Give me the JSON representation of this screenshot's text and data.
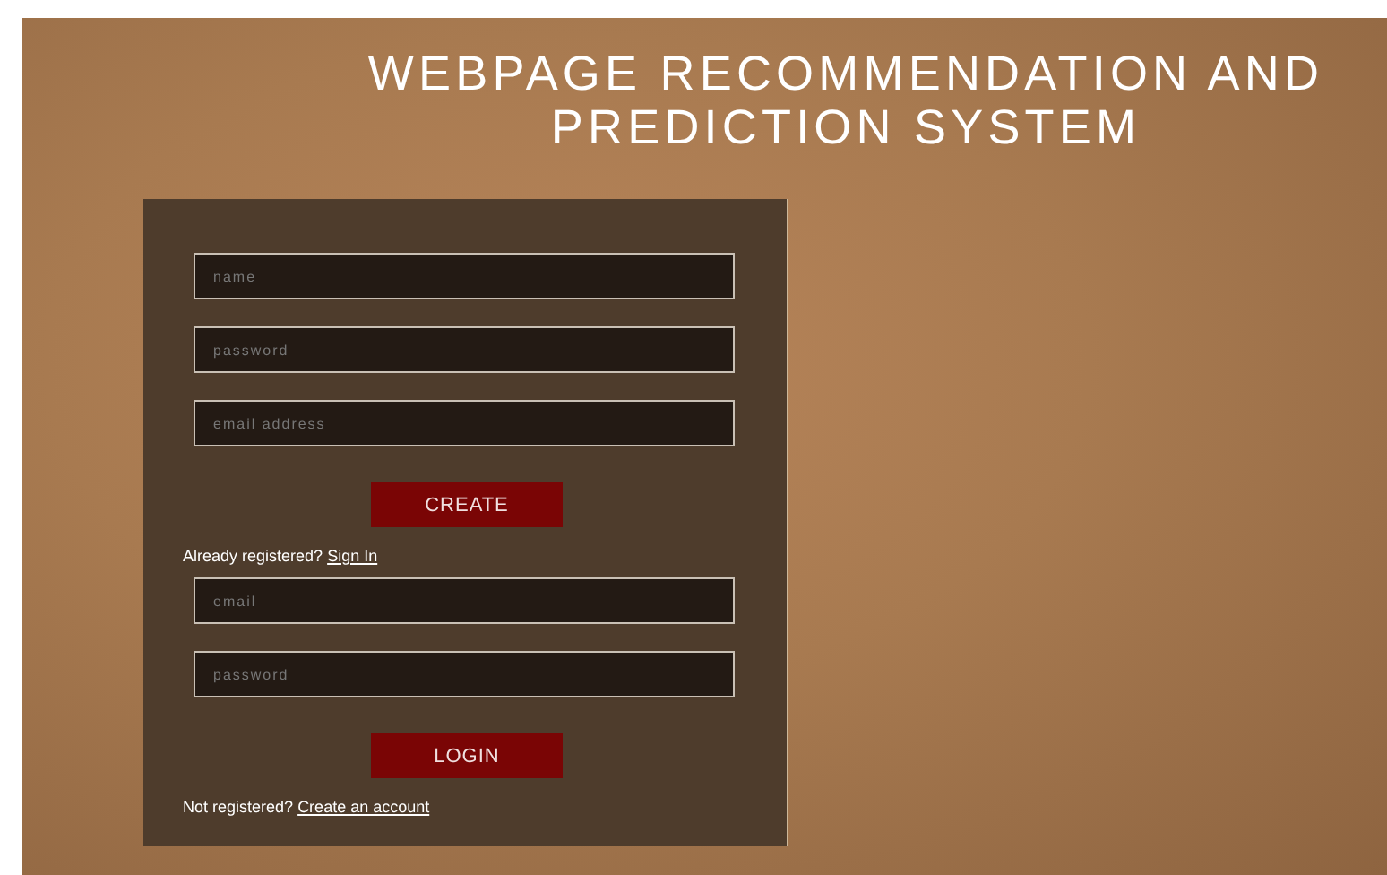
{
  "title": "WEBPAGE RECOMMENDATION AND PREDICTION SYSTEM",
  "register_form": {
    "fields": [
      {
        "placeholder": "name"
      },
      {
        "placeholder": "password"
      },
      {
        "placeholder": "email address"
      }
    ],
    "button": "CREATE",
    "prompt": "Already registered?",
    "link": "Sign In"
  },
  "login_form": {
    "fields": [
      {
        "placeholder": "email"
      },
      {
        "placeholder": "password"
      }
    ],
    "button": "LOGIN",
    "prompt": "Not registered?",
    "link": "Create an account"
  }
}
